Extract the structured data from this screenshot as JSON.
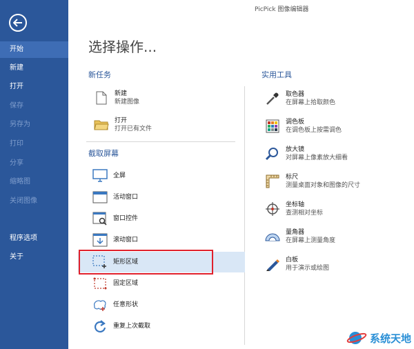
{
  "app_title": "PicPick 图像编辑器",
  "sidebar": {
    "items": [
      {
        "label": "开始",
        "state": "active"
      },
      {
        "label": "新建",
        "state": "normal"
      },
      {
        "label": "打开",
        "state": "normal"
      },
      {
        "label": "保存",
        "state": "disabled"
      },
      {
        "label": "另存为",
        "state": "disabled"
      },
      {
        "label": "打印",
        "state": "disabled"
      },
      {
        "label": "分享",
        "state": "disabled"
      },
      {
        "label": "缩略图",
        "state": "disabled"
      },
      {
        "label": "关闭图像",
        "state": "disabled"
      },
      {
        "label": "程序选项",
        "state": "normal"
      },
      {
        "label": "关于",
        "state": "normal"
      }
    ]
  },
  "main": {
    "title": "选择操作...",
    "new_task": {
      "heading": "新任务",
      "items": [
        {
          "label": "新建",
          "desc": "新建图像",
          "icon": "new-file-icon"
        },
        {
          "label": "打开",
          "desc": "打开已有文件",
          "icon": "open-folder-icon"
        }
      ]
    },
    "capture": {
      "heading": "截取屏幕",
      "items": [
        {
          "label": "全屏",
          "icon": "monitor-icon"
        },
        {
          "label": "活动窗口",
          "icon": "window-icon"
        },
        {
          "label": "窗口控件",
          "icon": "window-control-icon"
        },
        {
          "label": "滚动窗口",
          "icon": "scroll-window-icon"
        },
        {
          "label": "矩形区域",
          "icon": "rectangle-region-icon",
          "highlighted": true
        },
        {
          "label": "固定区域",
          "icon": "fixed-region-icon"
        },
        {
          "label": "任意形状",
          "icon": "freehand-icon"
        },
        {
          "label": "重复上次截取",
          "icon": "repeat-icon"
        }
      ]
    },
    "tools": {
      "heading": "实用工具",
      "items": [
        {
          "label": "取色器",
          "desc": "在屏幕上拾取颜色",
          "icon": "eyedropper-icon"
        },
        {
          "label": "调色板",
          "desc": "在调色板上按需调色",
          "icon": "palette-icon"
        },
        {
          "label": "放大镜",
          "desc": "对屏幕上像素放大细看",
          "icon": "magnifier-icon"
        },
        {
          "label": "标尺",
          "desc": "测量桌面对象和图像的尺寸",
          "icon": "ruler-icon"
        },
        {
          "label": "坐标轴",
          "desc": "查测相对坐标",
          "icon": "crosshair-icon"
        },
        {
          "label": "量角器",
          "desc": "在屏幕上测量角度",
          "icon": "protractor-icon"
        },
        {
          "label": "白板",
          "desc": "用于演示或绘图",
          "icon": "whiteboard-icon"
        }
      ]
    }
  },
  "watermark": {
    "text": "系统天地"
  },
  "colors": {
    "sidebar": "#2b579a",
    "accent": "#2b579a",
    "highlight": "#d9e7f6",
    "callout": "#e0202b"
  }
}
